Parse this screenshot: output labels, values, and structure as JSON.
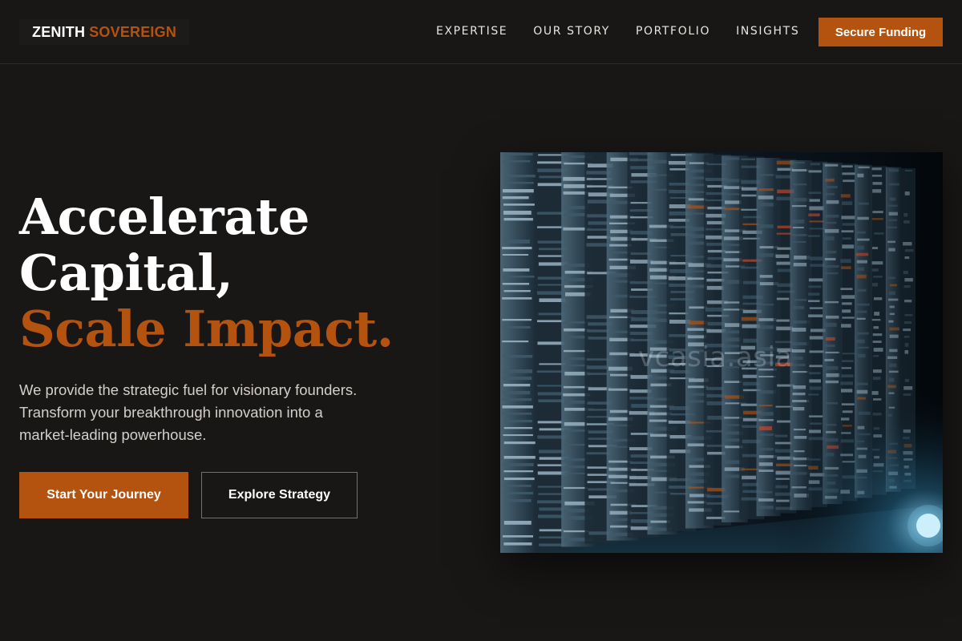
{
  "header": {
    "logo": {
      "part1": "ZENITH",
      "part2": "SOVEREIGN"
    },
    "nav": [
      {
        "label": "EXPERTISE"
      },
      {
        "label": "OUR STORY"
      },
      {
        "label": "PORTFOLIO"
      },
      {
        "label": "INSIGHTS"
      }
    ],
    "cta_label": "Secure Funding"
  },
  "hero": {
    "title_line1": "Accelerate",
    "title_line2": "Capital,",
    "title_line3": "Scale Impact.",
    "description_lines": [
      "We provide the strategic fuel for visionary founders.",
      "Transform your breakthrough innovation into a",
      "market-leading powerhouse."
    ],
    "primary_button": "Start Your Journey",
    "secondary_button": "Explore Strategy",
    "image": {
      "subject": "server-racks-photo",
      "watermark": "vcasia.asia"
    }
  },
  "colors": {
    "background": "#181716",
    "accent": "#b4520f",
    "text": "#ffffff",
    "muted_text": "#d3cfca"
  }
}
